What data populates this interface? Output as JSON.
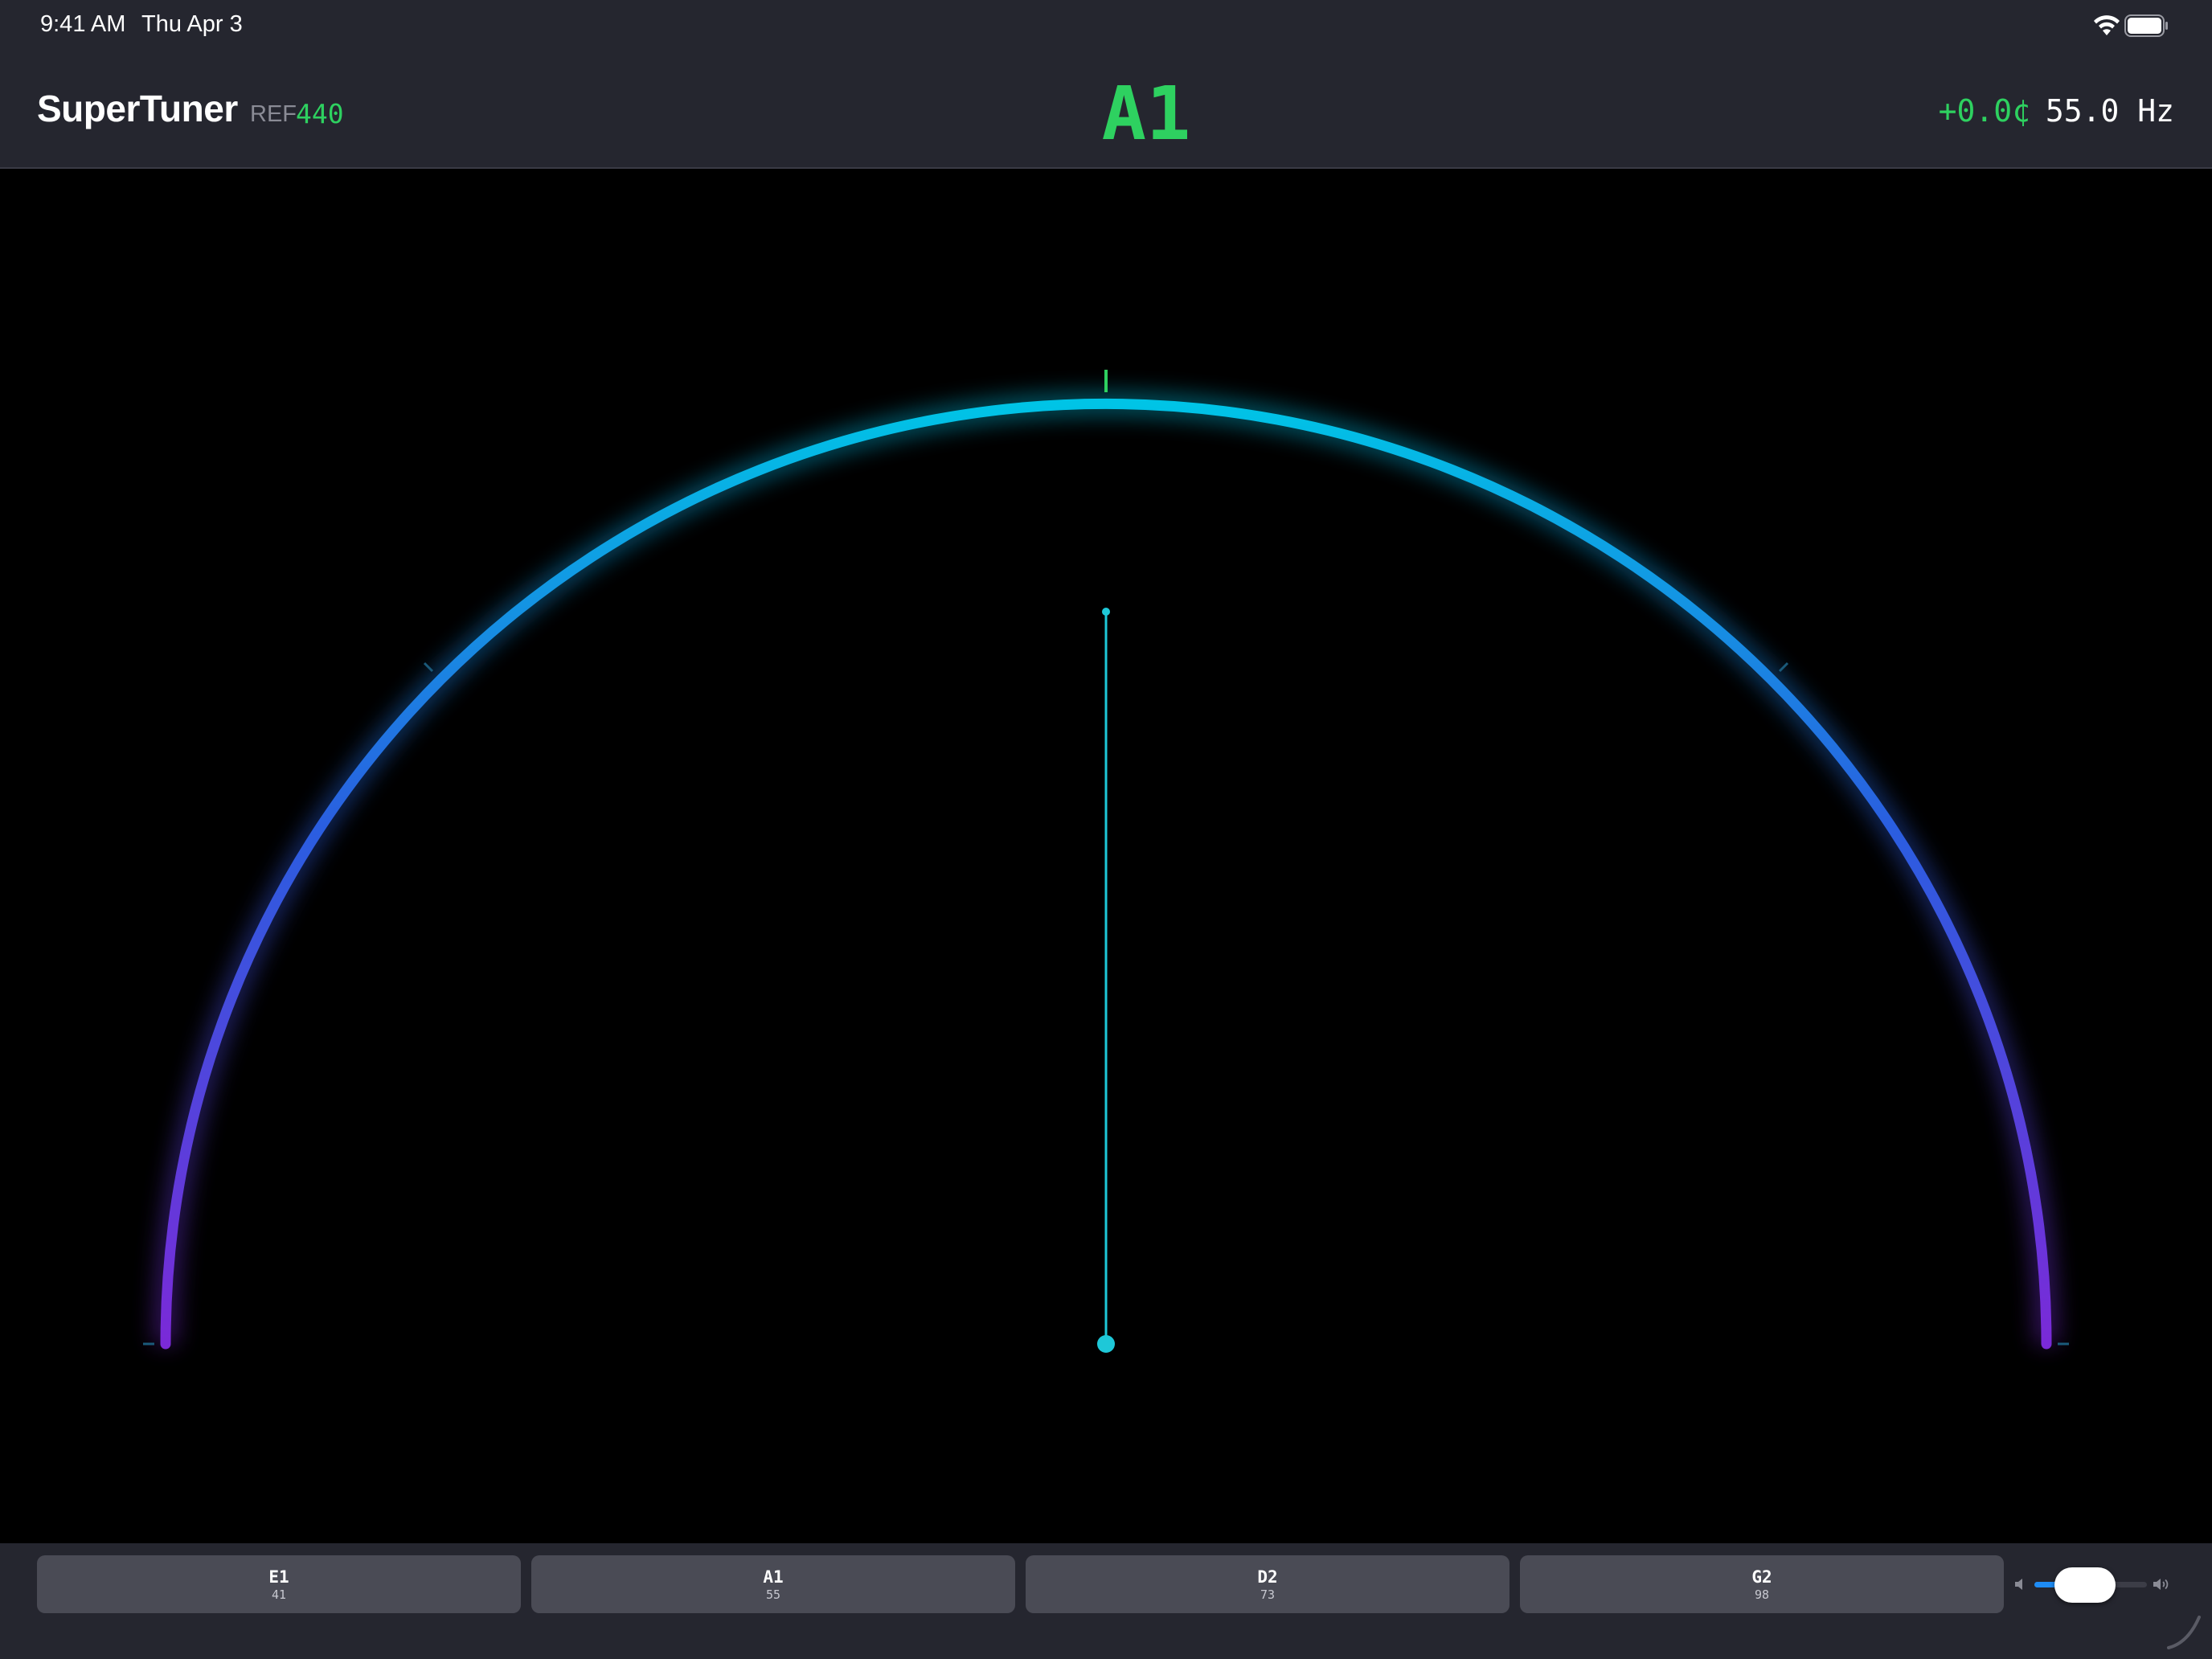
{
  "status_bar": {
    "time": "9:41 AM",
    "date": "Thu Apr 3"
  },
  "header": {
    "app_title": "SuperTuner",
    "ref_label": "REF",
    "ref_value": "440",
    "note": "A1",
    "cents": "+0.0¢",
    "frequency": "55.0 Hz"
  },
  "gauge": {
    "cents_offset": 0.0,
    "in_tune": true
  },
  "strings": [
    {
      "note": "E1",
      "freq": "41"
    },
    {
      "note": "A1",
      "freq": "55"
    },
    {
      "note": "D2",
      "freq": "73"
    },
    {
      "note": "G2",
      "freq": "98"
    }
  ],
  "volume": {
    "level": 0.45
  },
  "colors": {
    "accent_green": "#2ed160",
    "arc_top": "#00c4e6",
    "arc_mid": "#2a5ee0",
    "arc_ends": "#7a2ad8",
    "needle": "#1ec8d8",
    "panel": "#25262f",
    "button": "#4a4b55"
  },
  "icons": [
    "wifi-icon",
    "battery-icon",
    "volume-low-icon",
    "volume-high-icon",
    "resize-grip-icon"
  ]
}
